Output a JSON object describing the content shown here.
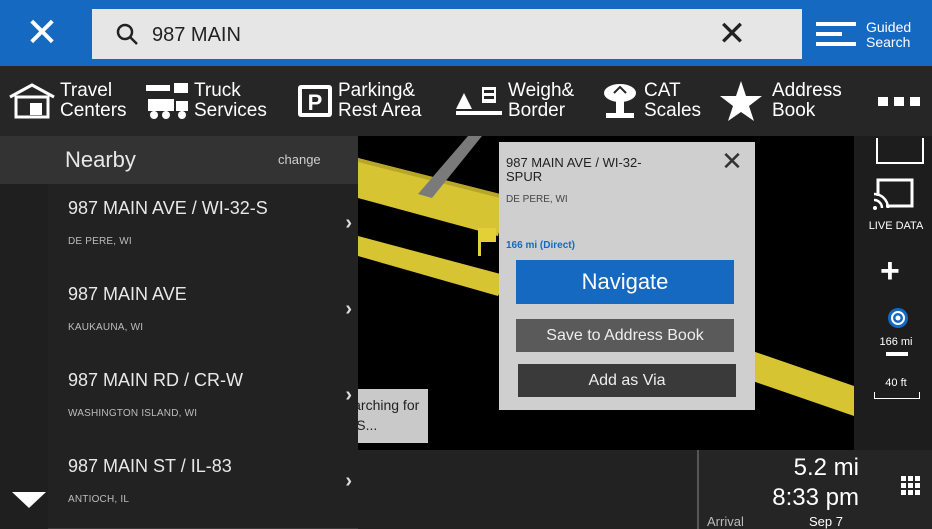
{
  "topbar": {
    "close_icon": "close-icon",
    "search": {
      "query": "987 MAIN",
      "icon": "search-icon"
    },
    "clear_icon": "clear-icon",
    "guided_search_label": "Guided Search"
  },
  "categories": [
    {
      "label": "Travel Centers",
      "icon": "travel-center-icon"
    },
    {
      "label": "Truck Services",
      "icon": "truck-services-icon"
    },
    {
      "label": "Parking& Rest Area",
      "icon": "parking-icon"
    },
    {
      "label": "Weigh& Border",
      "icon": "weigh-scale-icon"
    },
    {
      "label": "CAT Scales",
      "icon": "cat-scales-icon"
    },
    {
      "label": "Address Book",
      "icon": "star-icon"
    },
    {
      "label": "",
      "icon": "more-icon"
    }
  ],
  "nearby": {
    "title": "Nearby",
    "change_label": "change",
    "results": [
      {
        "title": "987 MAIN AVE / WI-32-S",
        "subtitle": "DE PERE, WI"
      },
      {
        "title": "987 MAIN AVE",
        "subtitle": "KAUKAUNA, WI"
      },
      {
        "title": "987 MAIN RD / CR-W",
        "subtitle": "WASHINGTON ISLAND, WI"
      },
      {
        "title": "987 MAIN ST / IL-83",
        "subtitle": "ANTIOCH, IL"
      }
    ]
  },
  "popup": {
    "title": "987 MAIN AVE / WI-32-SPUR",
    "subtitle": "DE PERE, WI",
    "distance": "166 mi (Direct)",
    "navigate_label": "Navigate",
    "save_label": "Save to Address Book",
    "via_label": "Add as Via"
  },
  "gps_status": "Searching for GPS...",
  "right_panel": {
    "live_data_label": "LIVE DATA",
    "zoom_label": "166 mi",
    "scale_label": "40 ft"
  },
  "trip": {
    "distance": "5.2 mi",
    "time": "8:33 pm",
    "arrival_label": "Arrival",
    "date": "Sep 7"
  },
  "colors": {
    "accent": "#1569c0",
    "road": "#e8d23a"
  }
}
